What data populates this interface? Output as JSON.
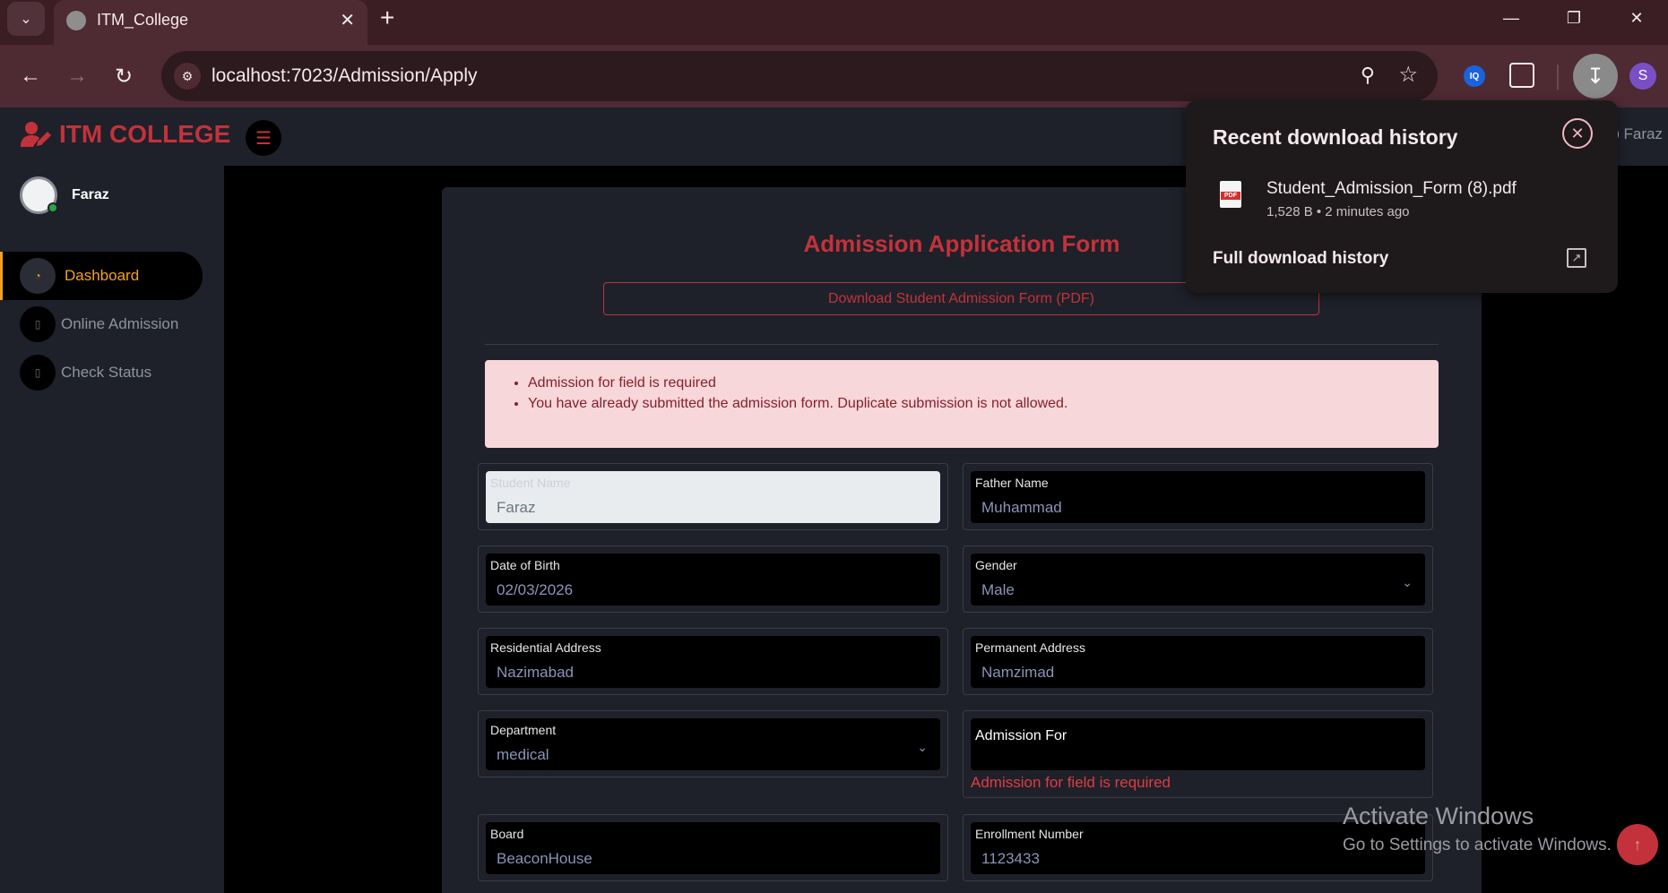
{
  "browser": {
    "tab_title": "ITM_College",
    "url": "localhost:7023/Admission/Apply",
    "profile_initial": "S",
    "iq_label": "IQ"
  },
  "app": {
    "brand": "ITM COLLEGE",
    "header_user": "Faraz"
  },
  "sidebar": {
    "username": "Faraz",
    "items": [
      {
        "label": "Dashboard",
        "active": true
      },
      {
        "label": "Online Admission",
        "active": false
      },
      {
        "label": "Check Status",
        "active": false
      }
    ]
  },
  "form": {
    "title": "Admission Application Form",
    "download_label": "Download Student Admission Form (PDF)",
    "errors": [
      "Admission for field is required",
      "You have already submitted the admission form. Duplicate submission is not allowed."
    ],
    "fields": {
      "student_name": {
        "label": "Student Name",
        "value": "Faraz"
      },
      "father_name": {
        "label": "Father Name",
        "value": "Muhammad"
      },
      "dob": {
        "label": "Date of Birth",
        "value": "02/03/2026"
      },
      "gender": {
        "label": "Gender",
        "value": "Male"
      },
      "residential_address": {
        "label": "Residential Address",
        "value": "Nazimabad"
      },
      "permanent_address": {
        "label": "Permanent Address",
        "value": "Namzimad"
      },
      "department": {
        "label": "Department",
        "value": "medical"
      },
      "admission_for": {
        "label": "Admission For",
        "error": "Admission for field is required"
      },
      "board": {
        "label": "Board",
        "value": "BeaconHouse"
      },
      "enrollment": {
        "label": "Enrollment Number",
        "value": "1123433"
      }
    }
  },
  "downloads": {
    "title": "Recent download history",
    "file_name": "Student_Admission_Form (8).pdf",
    "file_meta": "1,528 B • 2 minutes ago",
    "full_history": "Full download history",
    "pdf_badge": "PDF"
  },
  "watermark": {
    "title": "Activate Windows",
    "subtitle": "Go to Settings to activate Windows."
  },
  "colors": {
    "brand": "#c3323b",
    "active_nav": "#f4a11c",
    "error_bg": "#f8d7da",
    "error_text": "#842029"
  }
}
